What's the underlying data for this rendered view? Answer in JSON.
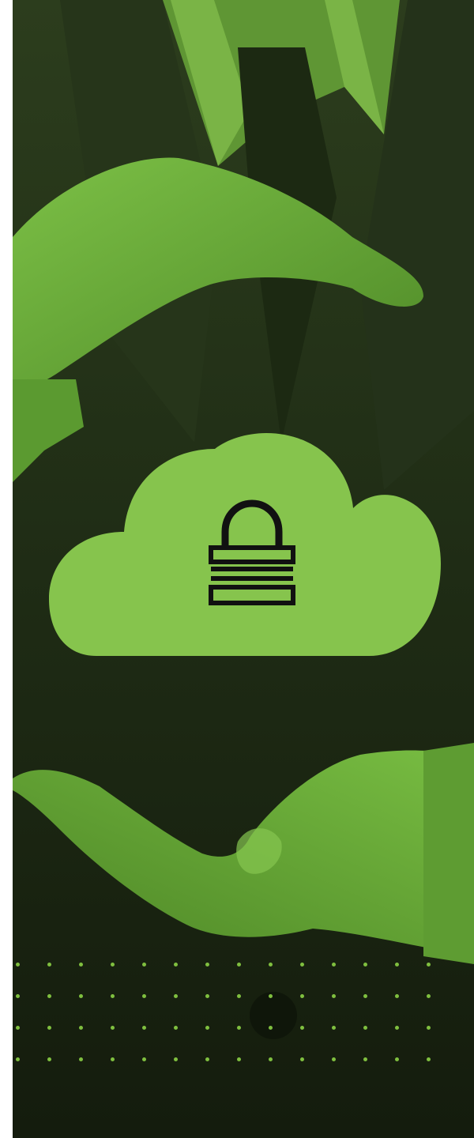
{
  "image": {
    "subject": "hands-protecting-cloud",
    "icon": "padlock-icon",
    "colors": {
      "background_dark": "#1b2612",
      "suit": "#2a3a1c",
      "shirt": "#6fa83a",
      "skin": "#6fb03a",
      "skin_shadow": "#3f6a1f",
      "cloud": "#86c44d",
      "lock": "#111111",
      "dot": "#7fbf3f"
    },
    "dot_grid": {
      "rows": 4,
      "cols": 14
    }
  }
}
